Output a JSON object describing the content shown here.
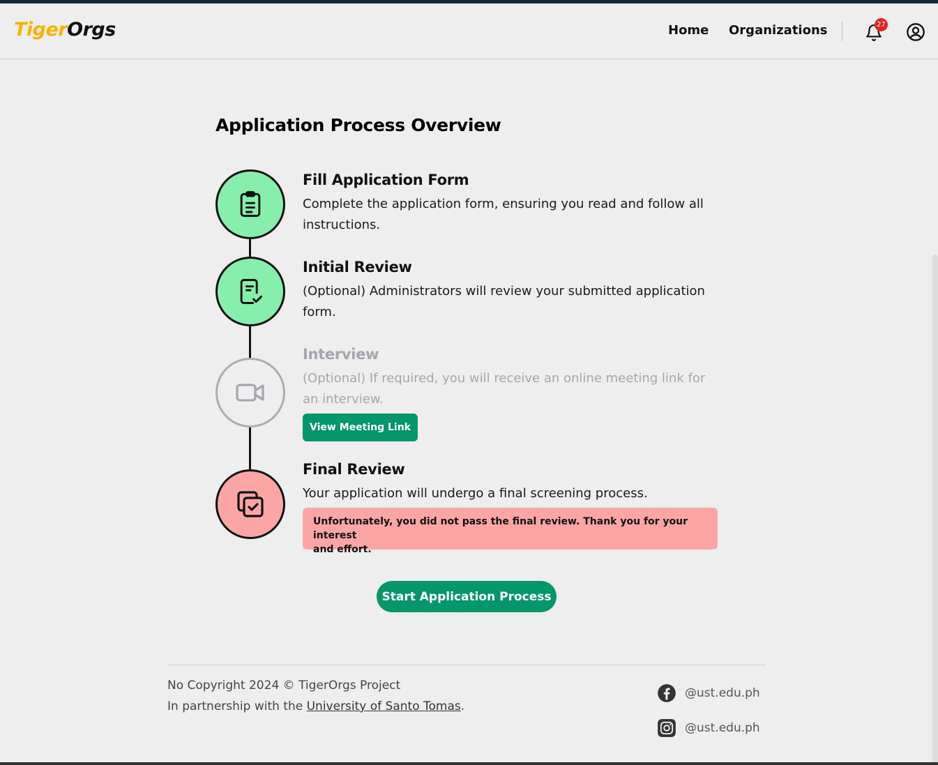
{
  "header": {
    "logo_part1": "Tiger",
    "logo_part2": "Orgs",
    "nav": {
      "home": "Home",
      "organizations": "Organizations"
    },
    "notification_count": "27"
  },
  "page_title": "Application Process Overview",
  "steps": [
    {
      "title": "Fill Application Form",
      "desc_line1": "Complete the application form, ensuring you read and follow all",
      "desc_line2": "instructions.",
      "status": "done",
      "icon": "clipboard-icon"
    },
    {
      "title": "Initial Review",
      "desc_line1": "(Optional) Administrators will review your submitted application",
      "desc_line2": "form.",
      "status": "done",
      "icon": "document-check-icon"
    },
    {
      "title": "Interview",
      "desc_line1": "(Optional) If required, you will receive an online meeting link for",
      "desc_line2": "an interview.",
      "status": "pending",
      "icon": "video-camera-icon",
      "button": "View Meeting Link"
    },
    {
      "title": "Final Review",
      "desc_line1": "Your application will undergo a final screening process.",
      "status": "failed",
      "icon": "copy-check-icon",
      "alert_line1": "Unfortunately, you did not pass the final review. Thank you for your interest",
      "alert_line2": "and effort."
    }
  ],
  "start_button": "Start Application Process",
  "footer": {
    "copyright": "No Copyright 2024 © TigerOrgs Project",
    "partnership_prefix": "In partnership with the ",
    "partnership_link": "University of Santo Tomas",
    "partnership_suffix": ".",
    "facebook": "@ust.edu.ph",
    "instagram": "@ust.edu.ph"
  },
  "colors": {
    "accent": "#059669",
    "done": "#86efac",
    "failed": "#fca5a5",
    "logo_yellow": "#f5b400",
    "badge": "#e02424"
  }
}
